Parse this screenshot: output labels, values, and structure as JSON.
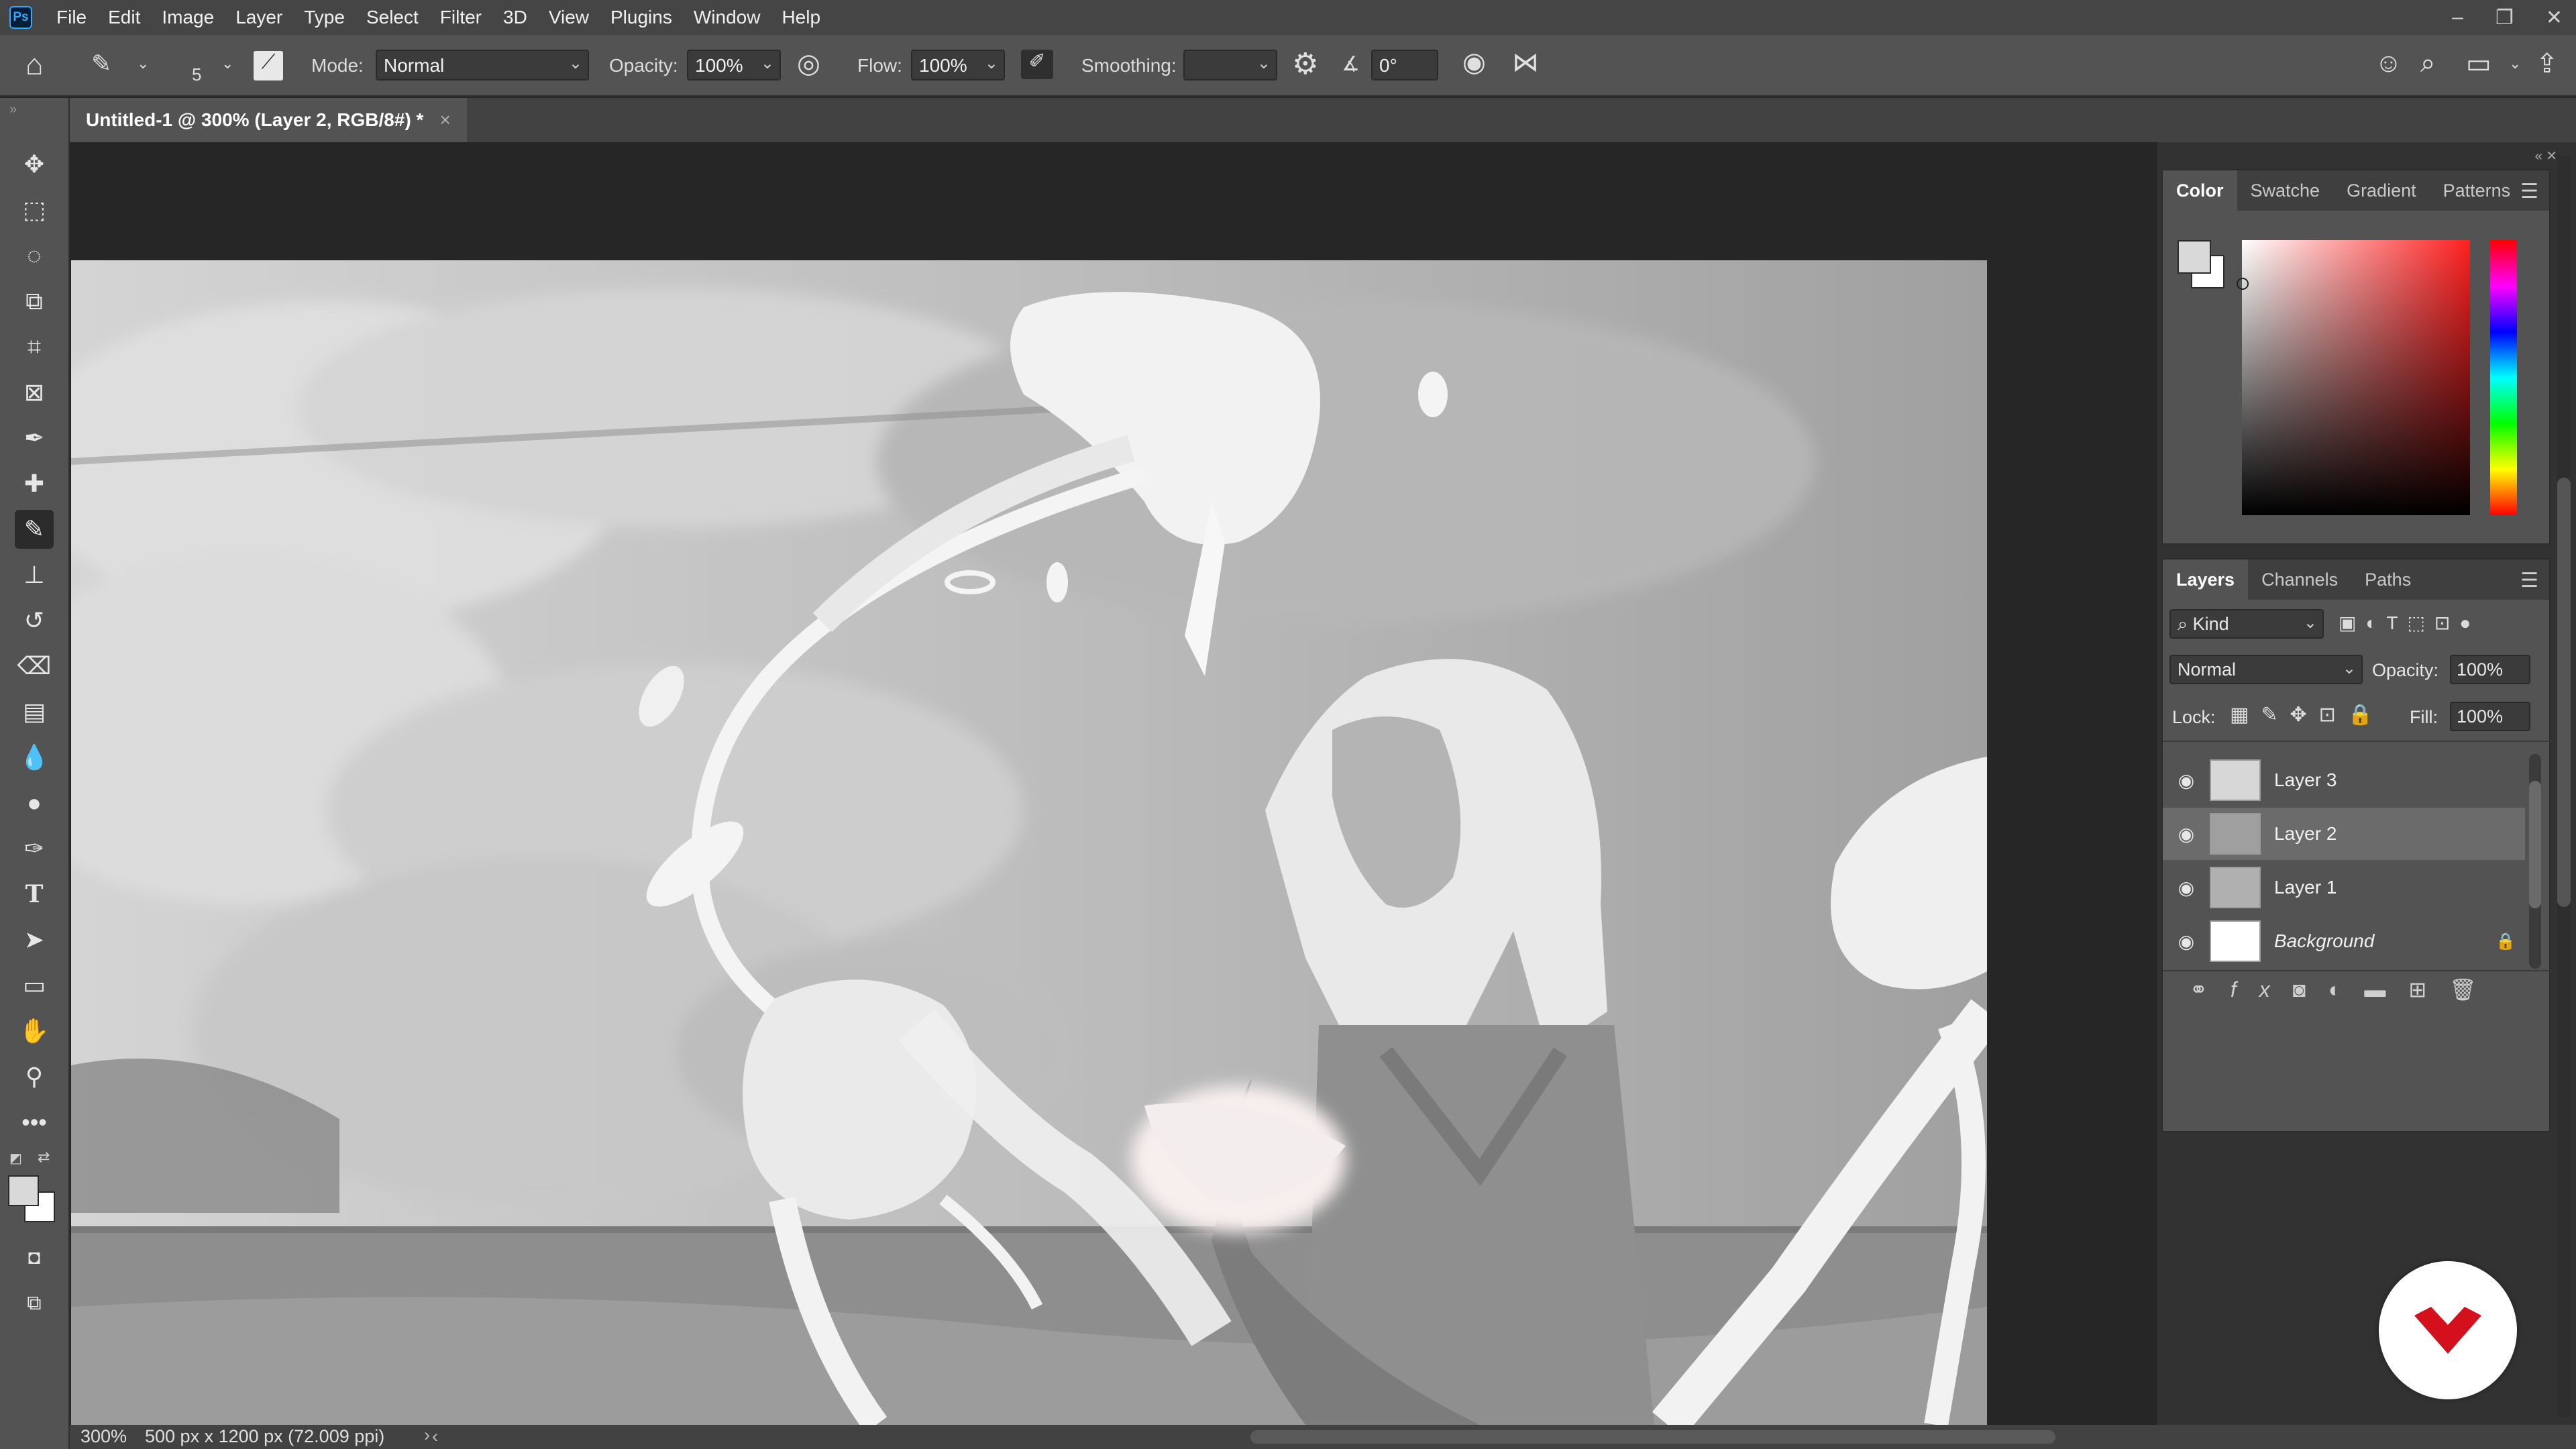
{
  "app": {
    "logo": "Ps",
    "menu": [
      "File",
      "Edit",
      "Image",
      "Layer",
      "Type",
      "Select",
      "Filter",
      "3D",
      "View",
      "Plugins",
      "Window",
      "Help"
    ]
  },
  "options": {
    "brush_size": "5",
    "mode_label": "Mode:",
    "mode_value": "Normal",
    "opacity_label": "Opacity:",
    "opacity_value": "100%",
    "flow_label": "Flow:",
    "flow_value": "100%",
    "smoothing_label": "Smoothing:",
    "smoothing_value": "",
    "angle_value": "0°"
  },
  "document": {
    "tab_title": "Untitled-1 @ 300% (Layer 2, RGB/8#) *",
    "close_symbol": "×"
  },
  "color_panel": {
    "tabs": [
      "Color",
      "Swatche",
      "Gradient",
      "Patterns"
    ],
    "active_tab": "Color",
    "foreground": "#d9d9d9",
    "background": "#ffffff",
    "picker_hue": "#ff2020"
  },
  "layers_panel": {
    "tabs": [
      "Layers",
      "Channels",
      "Paths"
    ],
    "active_tab": "Layers",
    "filter_label": "Kind",
    "blend_mode": "Normal",
    "opacity_label": "Opacity:",
    "opacity_value": "100%",
    "lock_label": "Lock:",
    "fill_label": "Fill:",
    "fill_value": "100%",
    "layers": [
      {
        "name": "Layer 3",
        "selected": false
      },
      {
        "name": "Layer 2",
        "selected": true
      },
      {
        "name": "Layer 1",
        "selected": false
      },
      {
        "name": "Background",
        "selected": false,
        "locked": true
      }
    ]
  },
  "status": {
    "zoom": "300%",
    "doc_info": "500 px x 1200 px (72.009 ppi)"
  }
}
